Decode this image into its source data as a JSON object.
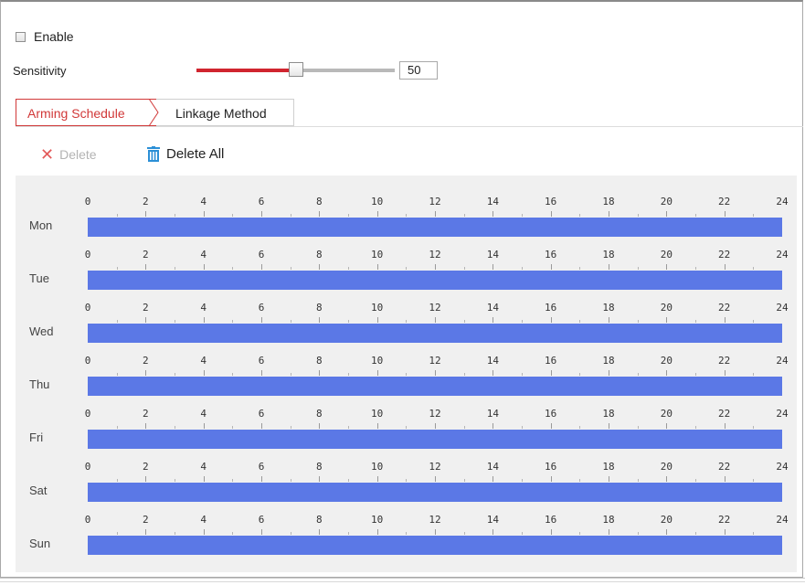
{
  "enable": {
    "label": "Enable",
    "checked": false
  },
  "sensitivity": {
    "label": "Sensitivity",
    "value": "50",
    "level_percent": 50,
    "fill_color": "#d0252f"
  },
  "tabs": [
    {
      "label": "Arming Schedule",
      "active": true,
      "color": "#d13838"
    },
    {
      "label": "Linkage Method",
      "active": false
    }
  ],
  "toolbar": {
    "delete_label": "Delete",
    "delete_icon": "close-x-icon",
    "delete_all_label": "Delete All",
    "delete_all_icon": "trash-icon"
  },
  "schedule": {
    "bar_color": "#5b78e6",
    "hour_labels": [
      "0",
      "2",
      "4",
      "6",
      "8",
      "10",
      "12",
      "14",
      "16",
      "18",
      "20",
      "22",
      "24"
    ],
    "days": [
      {
        "label": "Mon",
        "start": 0,
        "end": 24
      },
      {
        "label": "Tue",
        "start": 0,
        "end": 24
      },
      {
        "label": "Wed",
        "start": 0,
        "end": 24
      },
      {
        "label": "Thu",
        "start": 0,
        "end": 24
      },
      {
        "label": "Fri",
        "start": 0,
        "end": 24
      },
      {
        "label": "Sat",
        "start": 0,
        "end": 24
      },
      {
        "label": "Sun",
        "start": 0,
        "end": 24
      }
    ]
  }
}
